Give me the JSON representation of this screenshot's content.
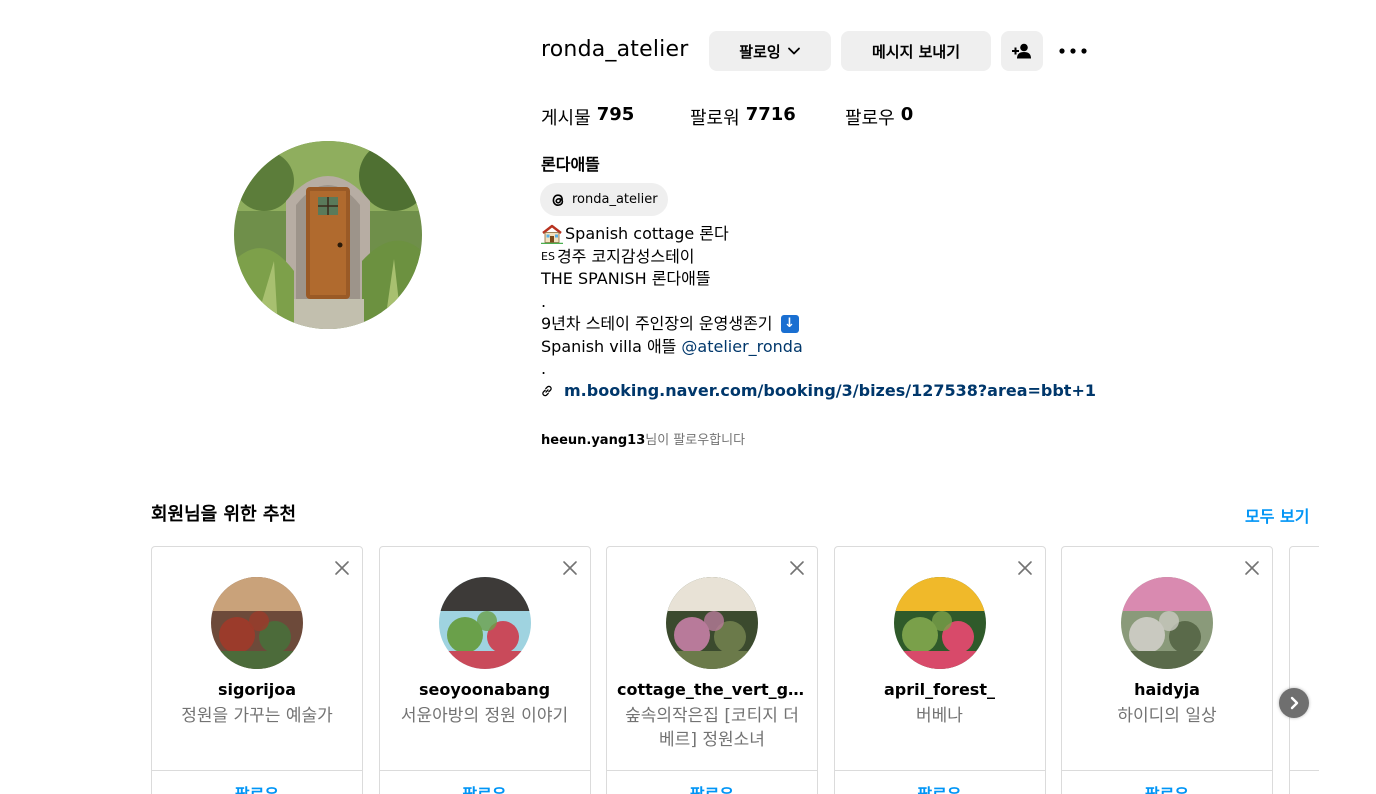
{
  "profile": {
    "username": "ronda_atelier",
    "following_button": "팔로잉",
    "message_button": "메시지 보내기",
    "full_name": "론다애뜰",
    "threads_handle": "ronda_atelier",
    "stats": {
      "posts_label": "게시물",
      "posts_count": "795",
      "followers_label": "팔로워",
      "followers_count": "7716",
      "following_label": "팔로우",
      "following_count": "0"
    },
    "bio": {
      "line1": "Spanish cottage 론다",
      "line2_prefix": "ES",
      "line2": "경주 코지감성스테이",
      "line3": "THE SPANISH 론다애뜰",
      "line4": ".",
      "line5": "9년차 스테이 주인장의 운영생존기",
      "line5_icon": "↓",
      "line6": "Spanish villa 애뜰",
      "line6_mention": "@atelier_ronda",
      "line7": "."
    },
    "link_url": "m.booking.naver.com/booking/3/bizes/127538?area=bbt+1",
    "followed_by_user": "heeun.yang13",
    "followed_by_suffix": "님이 팔로우합니다"
  },
  "suggestions": {
    "title": "회원님을 위한 추천",
    "see_all": "모두 보기",
    "follow_label": "팔로우",
    "cards": [
      {
        "name": "sigorijoa",
        "desc": "정원을 가꾸는 예술가",
        "palette": [
          "#6d4a3a",
          "#c9a27a",
          "#4c6b3a",
          "#9b3b2b"
        ]
      },
      {
        "name": "seoyoonabang",
        "desc": "서윤아방의 정원 이야기",
        "palette": [
          "#9fd3e0",
          "#3d3a38",
          "#c94a5a",
          "#6aa04a"
        ]
      },
      {
        "name": "cottage_the_vert_garden",
        "desc": "숲속의작은집 [코티지 더베르] 정원소녀",
        "palette": [
          "#3b4a2e",
          "#e8e2d6",
          "#6b7a4a",
          "#b87a9a"
        ]
      },
      {
        "name": "april_forest_",
        "desc": "버베나",
        "palette": [
          "#2f5a2a",
          "#f0b92a",
          "#d84a6a",
          "#7aa04a"
        ]
      },
      {
        "name": "haidyja",
        "desc": "하이디의 일상",
        "palette": [
          "#8a9a7a",
          "#d98ab0",
          "#5a6a4a",
          "#c9c9c0"
        ]
      }
    ]
  },
  "icons": {
    "following_chevron": "chevron-down-icon",
    "suggest_user": "person-add-icon",
    "more": "more-horizontal-icon",
    "threads": "threads-icon",
    "house": "house-emoji-icon",
    "link": "link-icon",
    "close": "close-icon",
    "next": "chevron-right-icon"
  },
  "colors": {
    "accent_blue": "#0095f6",
    "link_dark_blue": "#00376b",
    "secondary_text": "#737373",
    "button_gray": "#efefef",
    "border": "#dbdbdb"
  }
}
